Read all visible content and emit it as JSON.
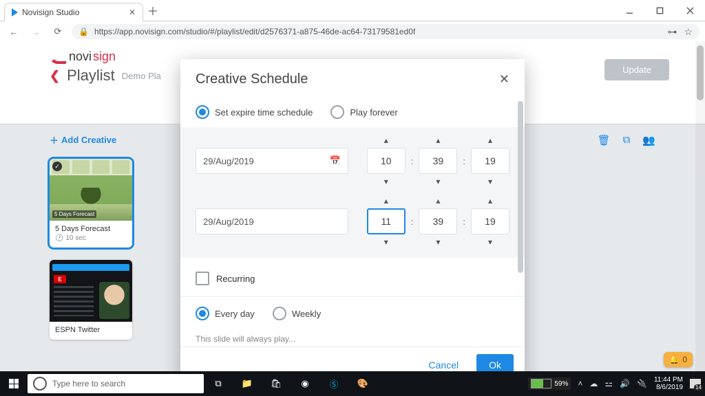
{
  "browser": {
    "tab_title": "Novisign Studio",
    "url": "https://app.novisign.com/studio/#/playlist/edit/d2576371-a875-46de-ac64-73179581ed0f"
  },
  "header": {
    "logo_a": "novi",
    "logo_b": "sign",
    "crumb_title": "Playlist",
    "crumb_sub": "Demo Pla",
    "update": "Update"
  },
  "toolbar": {
    "add_creative": "Add Creative"
  },
  "cards": [
    {
      "title": "5 Days Forecast",
      "duration": "10 sec",
      "banner": "5 Days Forecast"
    },
    {
      "title": "ESPN Twitter",
      "duration": ""
    }
  ],
  "modal": {
    "title": "Creative Schedule",
    "expire_label": "Set expire time schedule",
    "forever_label": "Play forever",
    "date1": "29/Aug/2019",
    "t1": {
      "h": "10",
      "m": "39",
      "s": "19"
    },
    "date2": "29/Aug/2019",
    "t2": {
      "h": "11",
      "m": "39",
      "s": "19"
    },
    "recurring": "Recurring",
    "every_day": "Every day",
    "weekly": "Weekly",
    "hint": "This slide will always play...",
    "cancel": "Cancel",
    "ok": "Ok"
  },
  "notif": {
    "count": "0"
  },
  "taskbar": {
    "search_placeholder": "Type here to search",
    "battery": "59%",
    "time": "11:44 PM",
    "date": "8/6/2019",
    "action_badge": "14"
  }
}
